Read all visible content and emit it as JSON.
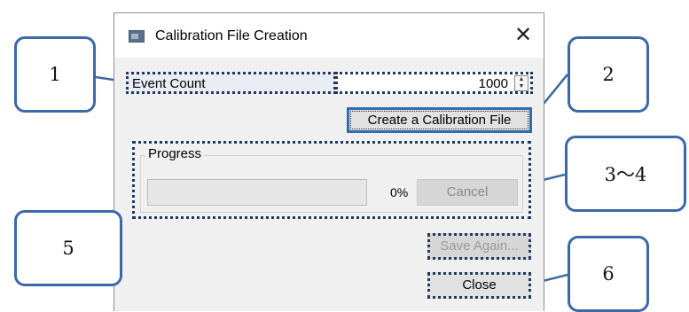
{
  "window": {
    "title": "Calibration File Creation",
    "app_icon": "app-window-icon",
    "close_glyph": "✕"
  },
  "event_count": {
    "label": "Event Count",
    "value": "1000",
    "spin_up_glyph": "▲",
    "spin_down_glyph": "▼"
  },
  "create_button": {
    "label": "Create a Calibration File"
  },
  "progress": {
    "group_title": "Progress",
    "percent_text": "0%",
    "fraction": 0,
    "cancel_label": "Cancel",
    "bar_fill_color": "#06b025"
  },
  "save_again_button": {
    "label": "Save Again..."
  },
  "close_button": {
    "label": "Close"
  },
  "callouts": [
    {
      "label": "1"
    },
    {
      "label": "2"
    },
    {
      "label": "3～4"
    },
    {
      "label": "5"
    },
    {
      "label": "6"
    }
  ],
  "colors": {
    "callout_border": "#3b68a8",
    "dotted_highlight": "#1f3864",
    "focus_border": "#2f6db1"
  }
}
